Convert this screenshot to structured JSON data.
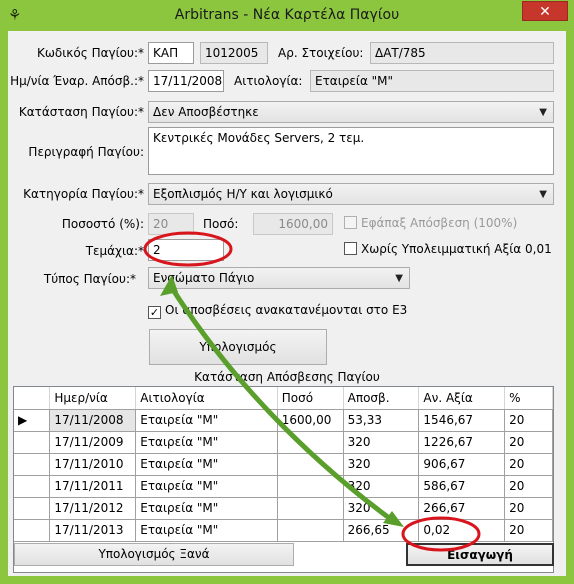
{
  "window": {
    "title": "Arbitrans - Νέα Καρτέλα Παγίου",
    "close": "✕"
  },
  "form": {
    "code_label": "Κωδικός Παγίου:*",
    "code_prefix": "ΚΑΠ",
    "code_number": "1012005",
    "asset_no_label": "Αρ. Στοιχείου:",
    "asset_no_value": "ΔΑΤ/785",
    "start_date_label": "Ημ/νία Έναρ. Απόσβ.:*",
    "start_date_value": "17/11/2008",
    "reason_label": "Αιτιολογία:",
    "reason_value": "Εταιρεία \"Μ\"",
    "status_label": "Κατάσταση Παγίου:*",
    "status_value": "Δεν Αποσβέστηκε",
    "description_label": "Περιγραφή Παγίου:",
    "description_value": "Κεντρικές Μονάδες Servers, 2 τεμ.",
    "category_label": "Κατηγορία Παγίου:*",
    "category_value": "Εξοπλισμός Η/Υ και λογισμικό",
    "percent_label": "Ποσοστό (%):",
    "percent_value": "20",
    "amount_label": "Ποσό:",
    "amount_value": "1600,00",
    "onetime_label": "Εφάπαξ Απόσβεση (100%)",
    "pieces_label": "Τεμάχια:*",
    "pieces_value": "2",
    "no_residual_label": "Χωρίς Υπολειμματική Αξία 0,01",
    "type_label": "Τύπος Παγίου:*",
    "type_value": "Ενσώματο Πάγιο",
    "redistribute_label": "Οι αποσβέσεις ανακατανέμονται στο Ε3",
    "calculate_button": "Υπολογισμός"
  },
  "schedule": {
    "title": "Κατάσταση Απόσβεσης Παγίου",
    "columns": [
      "Ημερ/νία",
      "Αιτιολογία",
      "Ποσό",
      "Αποσβ.",
      "Αν. Αξία",
      "%"
    ],
    "rows": [
      [
        "17/11/2008",
        "Εταιρεία \"Μ\"",
        "1600,00",
        "53,33",
        "1546,67",
        "20"
      ],
      [
        "17/11/2009",
        "Εταιρεία \"Μ\"",
        "",
        "320",
        "1226,67",
        "20"
      ],
      [
        "17/11/2010",
        "Εταιρεία \"Μ\"",
        "",
        "320",
        "906,67",
        "20"
      ],
      [
        "17/11/2011",
        "Εταιρεία \"Μ\"",
        "",
        "320",
        "586,67",
        "20"
      ],
      [
        "17/11/2012",
        "Εταιρεία \"Μ\"",
        "",
        "320",
        "266,67",
        "20"
      ],
      [
        "17/11/2013",
        "Εταιρεία \"Μ\"",
        "",
        "266,65",
        "0,02",
        "20"
      ]
    ]
  },
  "footer": {
    "recalc_button": "Υπολογισμός Ξανά",
    "insert_button": "Εισαγωγή"
  },
  "colors": {
    "frame": "#8cc63f",
    "annotation_arrow": "#5a9e2c",
    "annotation_circle": "#d8141c"
  }
}
